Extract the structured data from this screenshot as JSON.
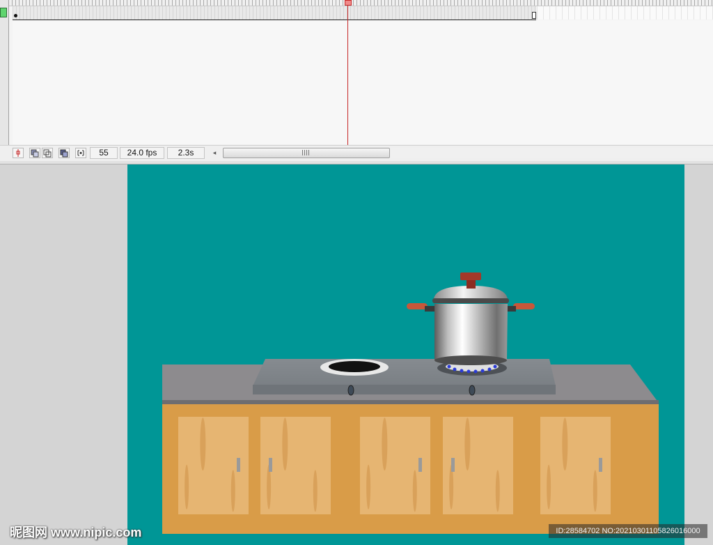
{
  "timeline": {
    "current_frame": "55",
    "frame_rate": "24.0 fps",
    "elapsed_time": "2.3s",
    "scrollbar_grip": "III",
    "scroll_left": "◂",
    "icons": [
      "center-frame-icon",
      "onion-skin-icon",
      "onion-skin-outlines-icon",
      "edit-multiple-frames-icon",
      "modify-markers-icon"
    ]
  },
  "watermarks": {
    "site": "昵图网 www.nipic.com",
    "id_text": "ID:28584702 NO:20210301105826016000"
  },
  "colors": {
    "stage_bg": "#009696",
    "cabinet": "#d99c48",
    "door": "#e6b572",
    "countertop": "#8d8b8e",
    "playhead": "#c62828",
    "layer_color": "#5fd46e"
  }
}
